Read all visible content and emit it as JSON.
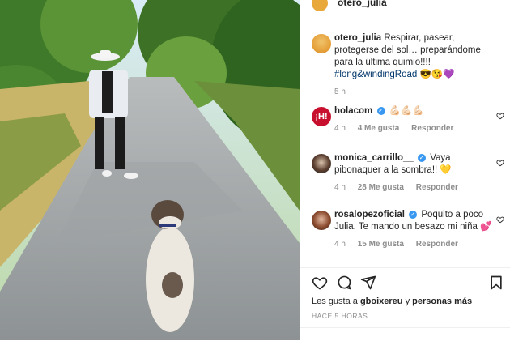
{
  "post": {
    "author": "otero_julia",
    "caption_user": "otero_julia",
    "caption_text": "Respirar, pasear, protegerse del sol… preparándome para la última quimio!!!!",
    "caption_hashtag": "#long",
    "caption_tail": "&windingRoad",
    "caption_emojis": "😎😘💜",
    "caption_time": "5 h"
  },
  "comments": [
    {
      "user": "holacom",
      "verified": true,
      "text": "💪🏻💪🏻💪🏻",
      "time": "4 h",
      "likes": "4 Me gusta",
      "reply": "Responder"
    },
    {
      "user": "monica_carrillo__",
      "verified": true,
      "text": "Vaya pibonaquer a la sombra!! 💛",
      "time": "4 h",
      "likes": "28 Me gusta",
      "reply": "Responder"
    },
    {
      "user": "rosalopezoficial",
      "verified": true,
      "text": "Poquito a poco Julia. Te mando un besazo mi niña 💕",
      "time": "4 h",
      "likes": "15 Me gusta",
      "reply": "Responder"
    }
  ],
  "likes_prefix": "Les gusta a",
  "likes_user": "gboixereu",
  "likes_mid": "y",
  "likes_others": "personas más",
  "posted_ago": "HACE 5 HORAS",
  "colors": {
    "verified": "#3897f0",
    "meta": "#8e8e8e",
    "hashtag": "#00376b"
  },
  "icons": [
    "heart-icon",
    "comment-icon",
    "share-icon",
    "bookmark-icon"
  ]
}
